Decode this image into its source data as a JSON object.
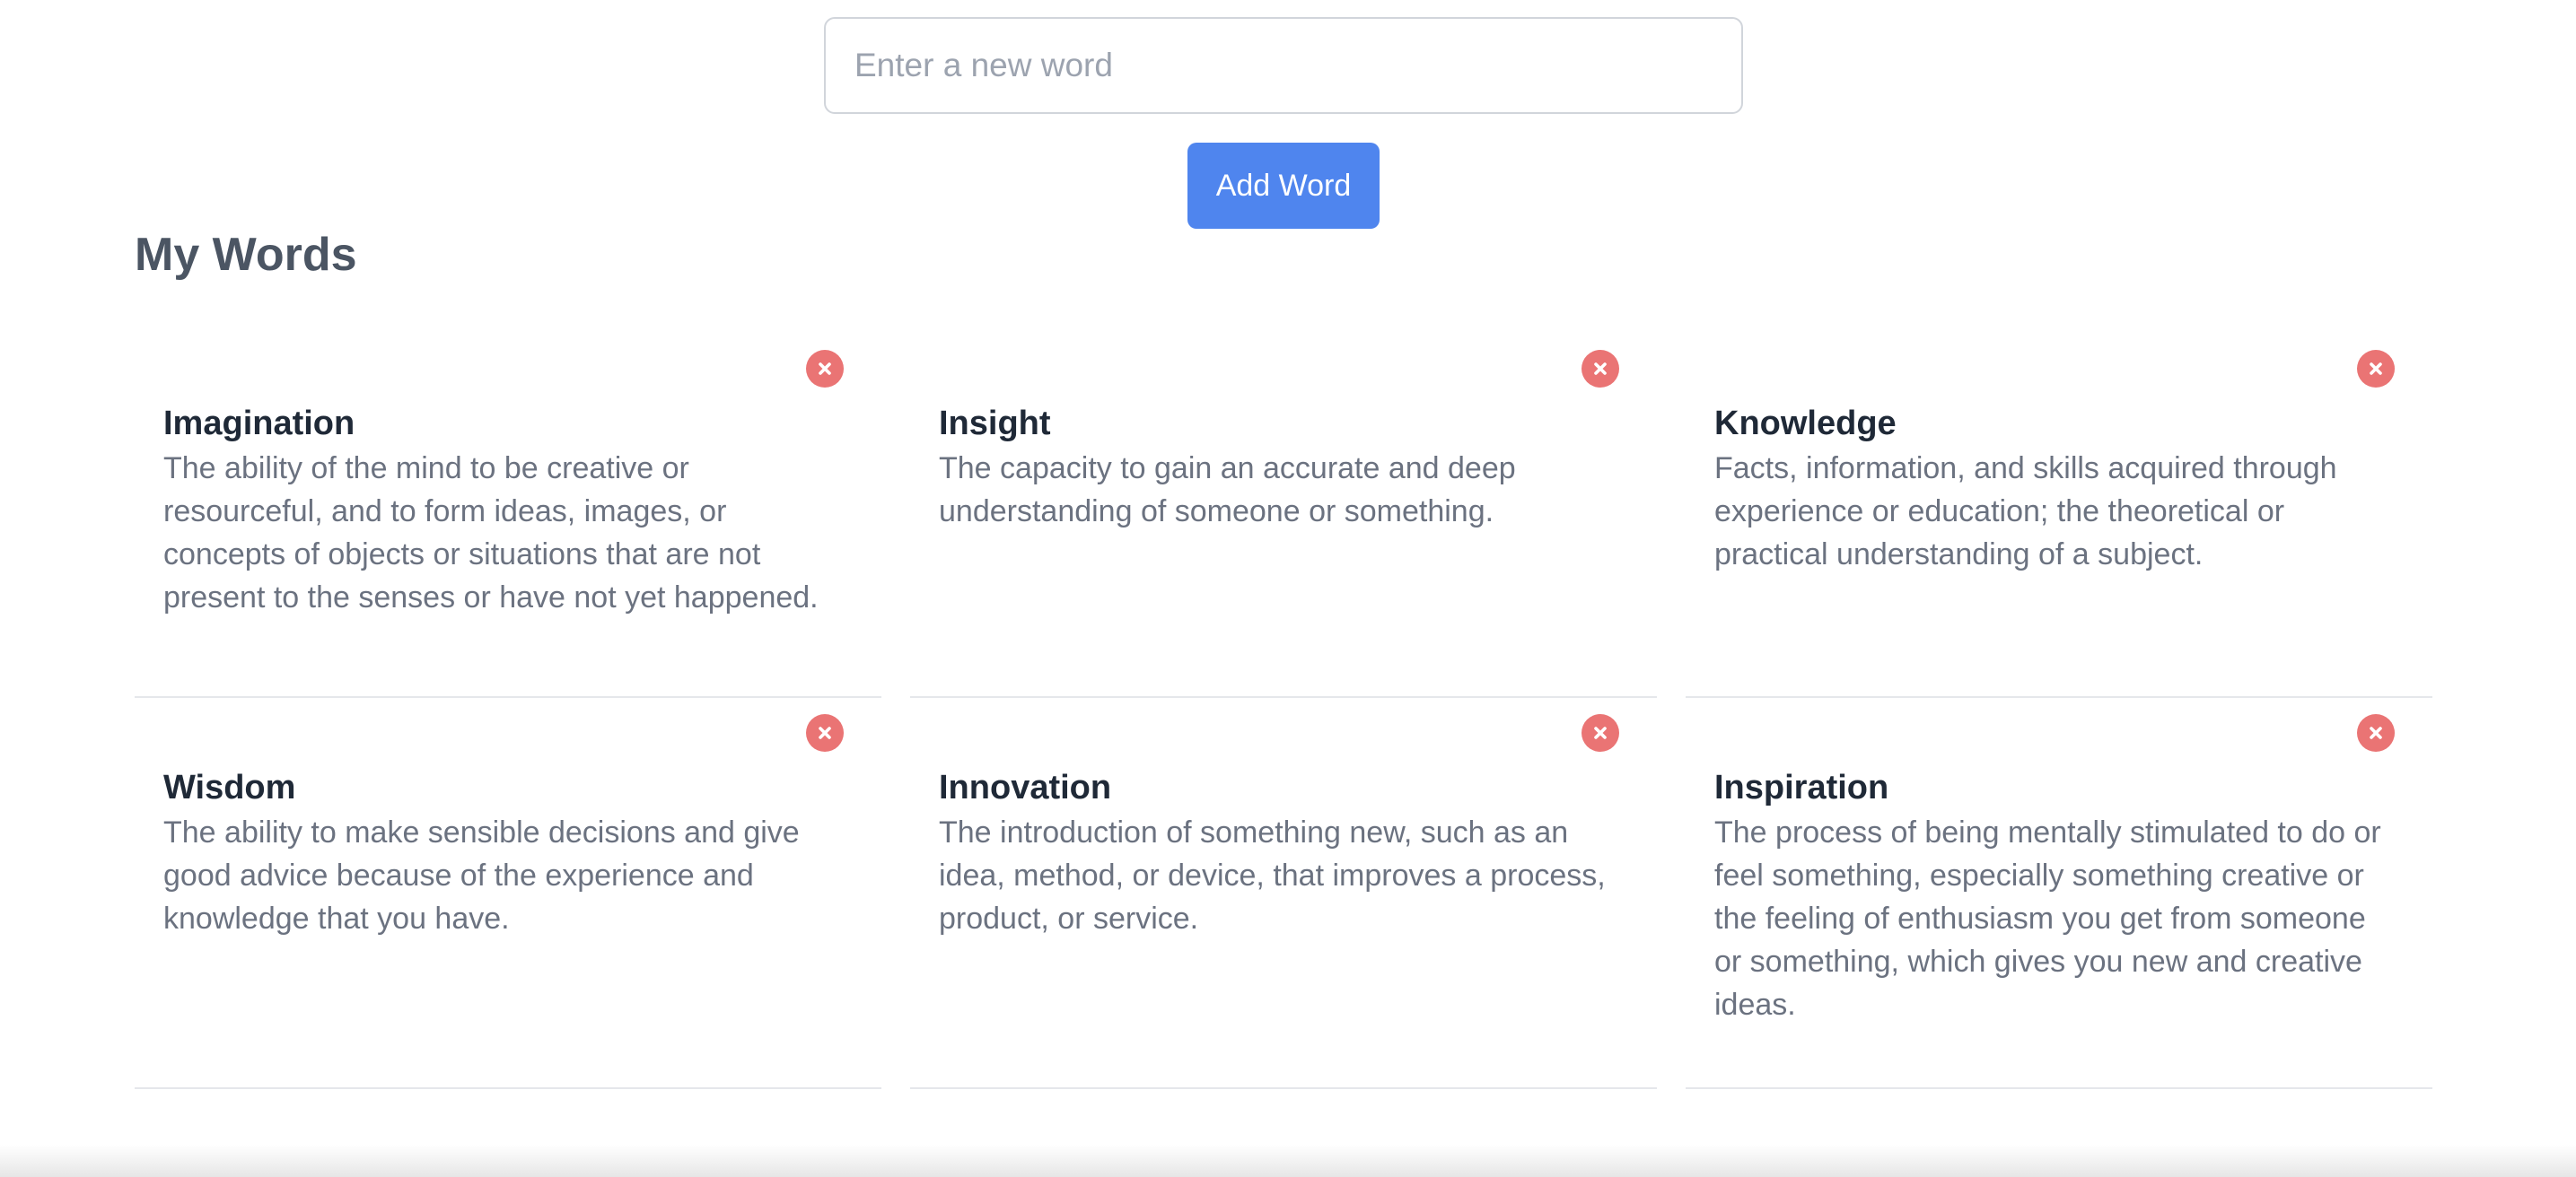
{
  "form": {
    "input_placeholder": "Enter a new word",
    "input_value": "",
    "add_button_label": "Add Word",
    "accent_color": "#4f85ee"
  },
  "section": {
    "title": "My Words"
  },
  "delete_icon": {
    "name": "close-circle-icon",
    "color": "#ea7474"
  },
  "words": [
    {
      "word": "Imagination",
      "definition": "The ability of the mind to be creative or resourceful, and to form ideas, images, or concepts of objects or situations that are not present to the senses or have not yet happened."
    },
    {
      "word": "Insight",
      "definition": "The capacity to gain an accurate and deep understanding of someone or something."
    },
    {
      "word": "Knowledge",
      "definition": "Facts, information, and skills acquired through experience or education; the theoretical or practical understanding of a subject."
    },
    {
      "word": "Wisdom",
      "definition": "The ability to make sensible decisions and give good advice because of the experience and knowledge that you have."
    },
    {
      "word": "Innovation",
      "definition": "The introduction of something new, such as an idea, method, or device, that improves a process, product, or service."
    },
    {
      "word": "Inspiration",
      "definition": "The process of being mentally stimulated to do or feel something, especially something creative or the feeling of enthusiasm you get from someone or something, which gives you new and creative ideas."
    }
  ]
}
